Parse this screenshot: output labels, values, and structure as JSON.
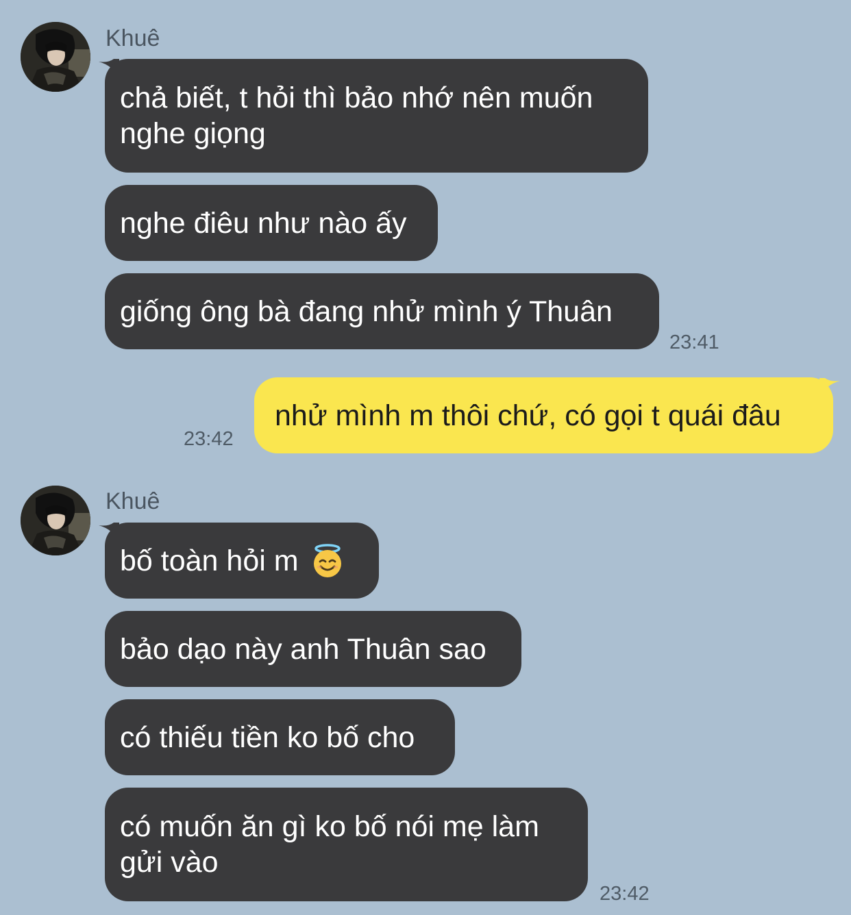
{
  "chat": {
    "colors": {
      "background": "#abbfd1",
      "incoming_bubble": "#3a3a3c",
      "outgoing_bubble": "#fae64f"
    },
    "group1": {
      "sender": "Khuê",
      "messages": [
        "chả biết, t hỏi thì bảo nhớ nên muốn\nnghe giọng",
        "nghe điêu như nào ấy",
        "giống ông bà đang nhử mình ý Thuân"
      ],
      "time": "23:41"
    },
    "outgoing": {
      "message": "nhử mình m thôi chứ, có gọi t quái đâu",
      "time": "23:42"
    },
    "group2": {
      "sender": "Khuê",
      "messages": [
        "bố toàn hỏi m ",
        "bảo dạo này anh Thuân sao",
        "có thiếu tiền ko bố cho",
        "có muốn ăn gì ko bố nói mẹ làm\ngửi vào"
      ],
      "time": "23:42",
      "emoji": "smiling-face-with-halo"
    }
  }
}
